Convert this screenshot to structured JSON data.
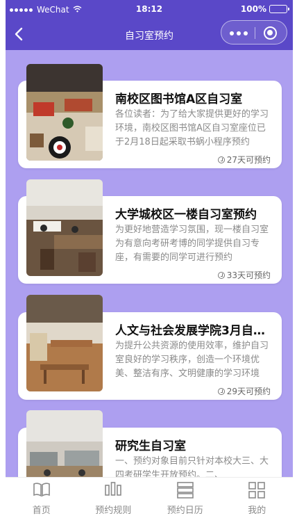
{
  "status_bar": {
    "carrier": "WeChat",
    "time": "18:12",
    "battery": "100%"
  },
  "nav": {
    "title": "自习室预约"
  },
  "rooms": [
    {
      "title": "南校区图书馆A区自习室",
      "desc": "各位读者：为了给大家提供更好的学习环境，南校区图书馆A区自习室座位已于2月18日起采取书蜗小程序预约",
      "avail": "27天可预约"
    },
    {
      "title": "大学城校区一楼自习室预约",
      "desc": "为更好地营造学习氛围，现一楼自习室为有意向考研考博的同学提供自习专座，有需要的同学可进行预约",
      "avail": "33天可预约"
    },
    {
      "title": "人文与社会发展学院3月自习室",
      "desc": "为提升公共资源的使用效率，维护自习室良好的学习秩序，创造一个环境优美、整洁有序、文明健康的学习环境",
      "avail": "29天可预约"
    },
    {
      "title": "研究生自习室",
      "desc": "一、预约对象目前只针对本校大三、大四考研学生开放预约。二、",
      "avail": ""
    }
  ],
  "tabs": [
    {
      "label": "首页",
      "icon": "book-icon"
    },
    {
      "label": "预约规则",
      "icon": "rules-icon"
    },
    {
      "label": "预约日历",
      "icon": "calendar-icon"
    },
    {
      "label": "我的",
      "icon": "grid-icon"
    }
  ]
}
